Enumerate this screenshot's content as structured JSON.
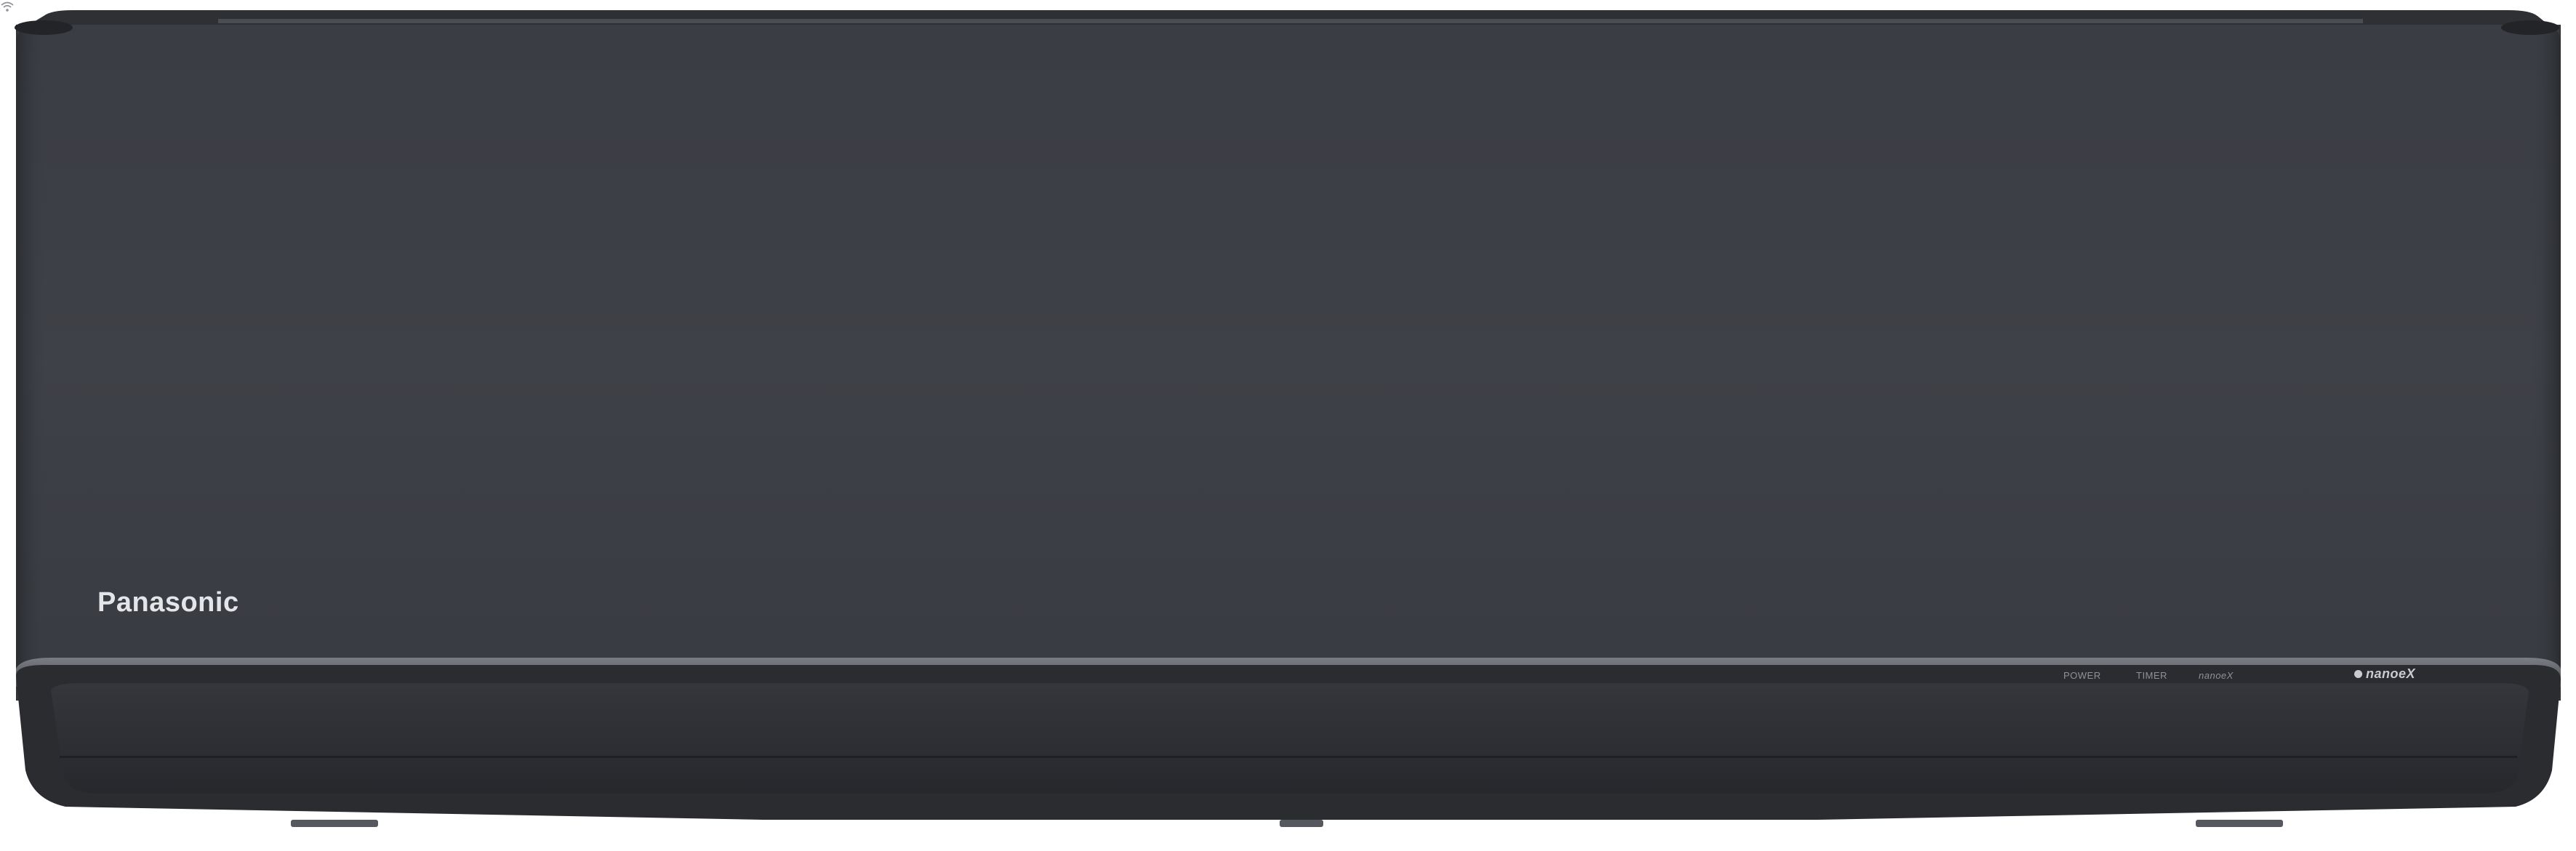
{
  "product": {
    "brand_logo": "Panasonic"
  },
  "indicators": {
    "power_label": "POWER",
    "timer_label": "TIMER",
    "nanoe_label": "nanoeX",
    "wifi_icon": "wifi-icon"
  },
  "nanoe_logo": {
    "text": "nanoeX"
  },
  "colors": {
    "body": "#3c3f45",
    "trim": "#6a6d73",
    "vane": "#2b2d31",
    "background": "#ffffff"
  }
}
